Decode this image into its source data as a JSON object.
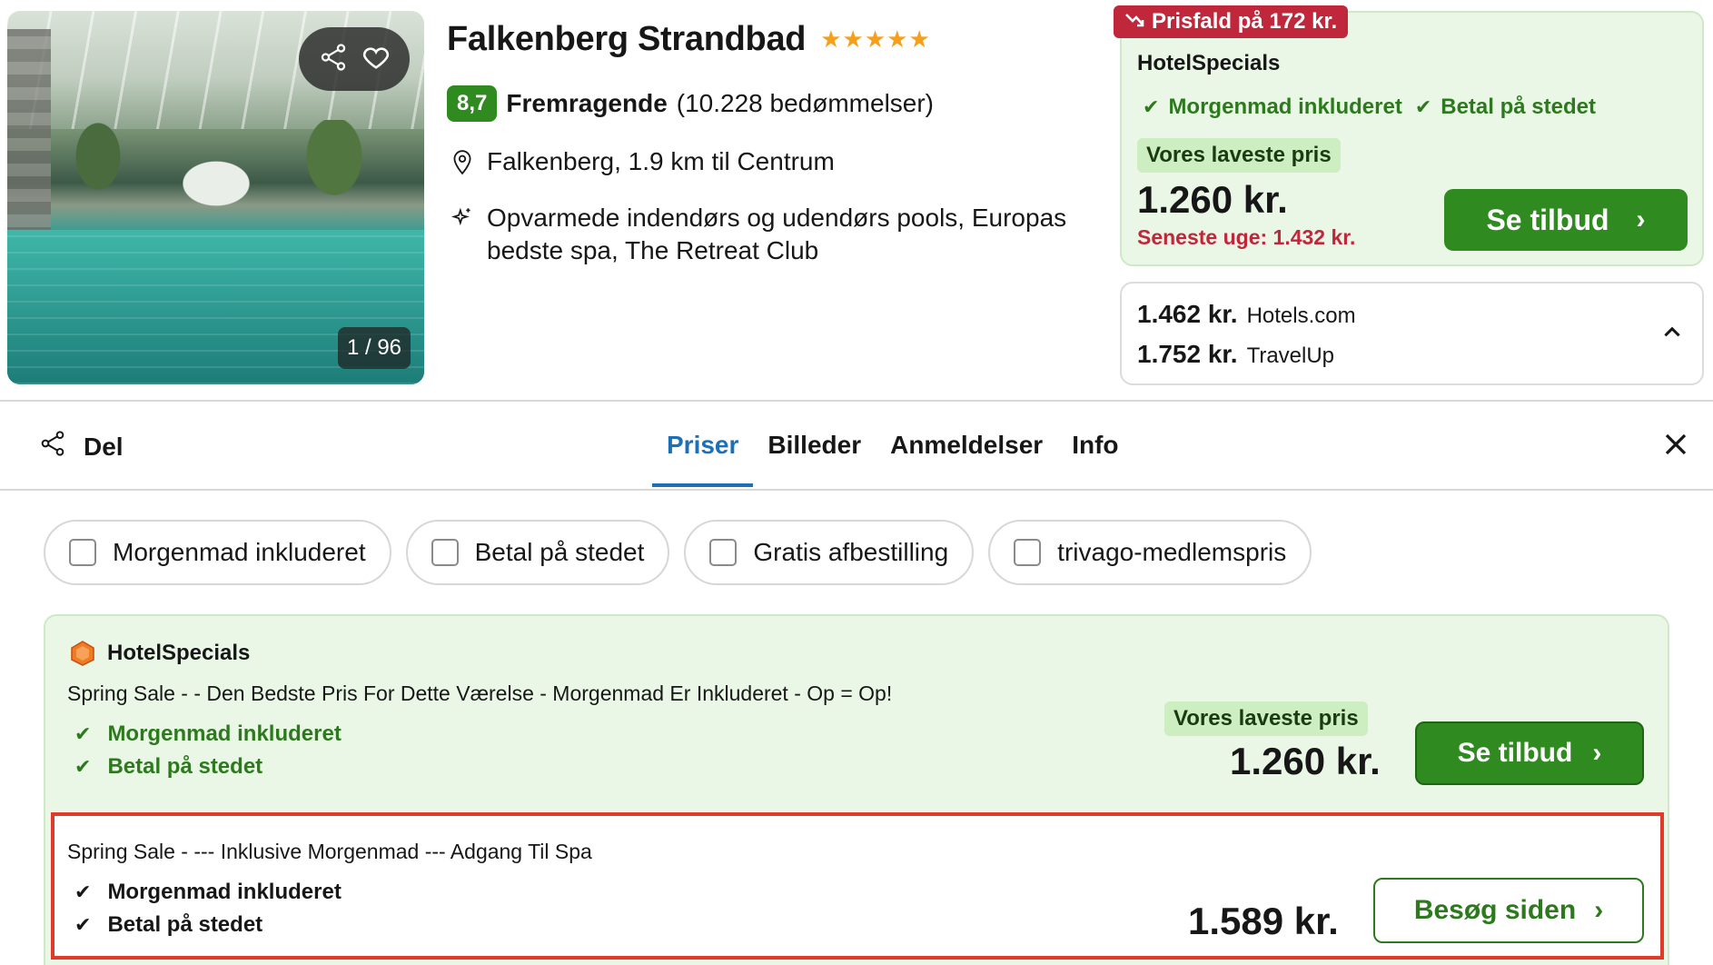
{
  "hotel": {
    "name": "Falkenberg Strandbad",
    "stars": "★★★★★",
    "rating_score": "8,7",
    "rating_label": "Fremragende",
    "rating_count": "(10.228 bedømmelser)",
    "location": "Falkenberg, 1.9 km til Centrum",
    "highlights_line1": "Opvarmede indendørs og udendørs pools, Europas",
    "highlights_line2": "bedste spa, The Retreat Club",
    "image_counter": "1 / 96"
  },
  "top_deal": {
    "price_drop": "Prisfald på 172 kr.",
    "provider": "HotelSpecials",
    "features": [
      "Morgenmad inkluderet",
      "Betal på stedet"
    ],
    "lowest_tag": "Vores laveste pris",
    "price": "1.260 kr.",
    "last_week": "Seneste uge: 1.432 kr.",
    "cta": "Se tilbud"
  },
  "alternatives": [
    {
      "price": "1.462 kr.",
      "site": "Hotels.com"
    },
    {
      "price": "1.752 kr.",
      "site": "TravelUp"
    }
  ],
  "nav": {
    "share": "Del",
    "tabs": [
      "Priser",
      "Billeder",
      "Anmeldelser",
      "Info"
    ],
    "active_tab": "Priser"
  },
  "filters": [
    "Morgenmad inkluderet",
    "Betal på stedet",
    "Gratis afbestilling",
    "trivago-medlemspris"
  ],
  "offers": {
    "provider": "HotelSpecials",
    "first": {
      "description": "Spring Sale - - Den Bedste Pris For Dette Værelse - Morgenmad Er Inkluderet - Op = Op!",
      "features": [
        "Morgenmad inkluderet",
        "Betal på stedet"
      ],
      "lowest_tag": "Vores laveste pris",
      "price": "1.260 kr.",
      "cta": "Se tilbud"
    },
    "second": {
      "description": "Spring Sale - --- Inklusive Morgenmad --- Adgang Til Spa",
      "features": [
        "Morgenmad inkluderet",
        "Betal på stedet"
      ],
      "price": "1.589 kr.",
      "cta": "Besøg siden"
    }
  },
  "colors": {
    "accent_green": "#2f8a1f",
    "light_green_bg": "#eaf7e6",
    "price_drop_red": "#c0273b",
    "tab_active_blue": "#1f6fb5",
    "highlight_border": "#e03a2a"
  }
}
